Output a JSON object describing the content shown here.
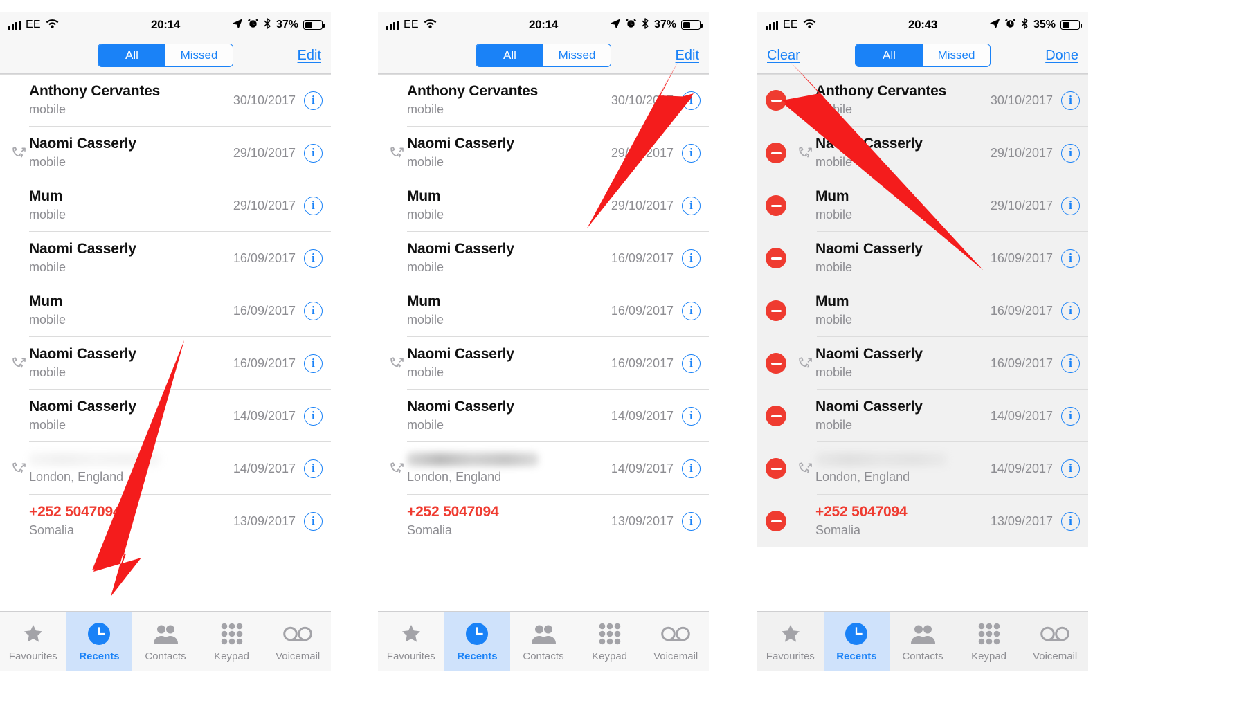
{
  "app": {
    "name": "Phone",
    "screen": "Recents"
  },
  "panels": [
    {
      "id": "panel-1",
      "status": {
        "signal_bars": 4,
        "carrier": "EE",
        "wifi": "wifi-icon",
        "time": "20:14",
        "location_icon": "location-arrow-icon",
        "alarm_icon": "alarm-icon",
        "bluetooth_icon": "bluetooth-icon",
        "battery_percent": "37%",
        "battery_level": 37
      },
      "nav": {
        "left_label": "",
        "segmented": [
          "All",
          "Missed"
        ],
        "selected_segment": "All",
        "right_label": "Edit"
      },
      "editing": false,
      "rows": [
        {
          "name": "Anthony Cervantes",
          "sub": "mobile",
          "date": "30/10/2017",
          "direction": "",
          "missed": false,
          "blurred": false
        },
        {
          "name": "Naomi Casserly",
          "sub": "mobile",
          "date": "29/10/2017",
          "direction": "outgoing",
          "missed": false,
          "blurred": false
        },
        {
          "name": "Mum",
          "sub": "mobile",
          "date": "29/10/2017",
          "direction": "",
          "missed": false,
          "blurred": false
        },
        {
          "name": "Naomi Casserly",
          "sub": "mobile",
          "date": "16/09/2017",
          "direction": "",
          "missed": false,
          "blurred": false
        },
        {
          "name": "Mum",
          "sub": "mobile",
          "date": "16/09/2017",
          "direction": "",
          "missed": false,
          "blurred": false
        },
        {
          "name": "Naomi Casserly",
          "sub": "mobile",
          "date": "16/09/2017",
          "direction": "outgoing",
          "missed": false,
          "blurred": false
        },
        {
          "name": "Naomi Casserly",
          "sub": "mobile",
          "date": "14/09/2017",
          "direction": "",
          "missed": false,
          "blurred": false
        },
        {
          "name": "",
          "sub": "London, England",
          "date": "14/09/2017",
          "direction": "outgoing",
          "missed": false,
          "blurred": true
        },
        {
          "name": "+252 5047094",
          "sub": "Somalia",
          "date": "13/09/2017",
          "direction": "",
          "missed": true,
          "blurred": false
        }
      ],
      "tabs": [
        {
          "label": "Favourites",
          "icon": "star-icon",
          "active": false
        },
        {
          "label": "Recents",
          "icon": "clock-icon",
          "active": true
        },
        {
          "label": "Contacts",
          "icon": "people-icon",
          "active": false
        },
        {
          "label": "Keypad",
          "icon": "keypad-icon",
          "active": false
        },
        {
          "label": "Voicemail",
          "icon": "voicemail-icon",
          "active": false
        }
      ]
    },
    {
      "id": "panel-2",
      "status": {
        "signal_bars": 4,
        "carrier": "EE",
        "wifi": "wifi-icon",
        "time": "20:14",
        "location_icon": "location-arrow-icon",
        "alarm_icon": "alarm-icon",
        "bluetooth_icon": "bluetooth-icon",
        "battery_percent": "37%",
        "battery_level": 37
      },
      "nav": {
        "left_label": "",
        "segmented": [
          "All",
          "Missed"
        ],
        "selected_segment": "All",
        "right_label": "Edit"
      },
      "editing": false,
      "rows": [
        {
          "name": "Anthony Cervantes",
          "sub": "mobile",
          "date": "30/10/2017",
          "direction": "",
          "missed": false,
          "blurred": false
        },
        {
          "name": "Naomi Casserly",
          "sub": "mobile",
          "date": "29/10/2017",
          "direction": "outgoing",
          "missed": false,
          "blurred": false
        },
        {
          "name": "Mum",
          "sub": "mobile",
          "date": "29/10/2017",
          "direction": "",
          "missed": false,
          "blurred": false
        },
        {
          "name": "Naomi Casserly",
          "sub": "mobile",
          "date": "16/09/2017",
          "direction": "",
          "missed": false,
          "blurred": false
        },
        {
          "name": "Mum",
          "sub": "mobile",
          "date": "16/09/2017",
          "direction": "",
          "missed": false,
          "blurred": false
        },
        {
          "name": "Naomi Casserly",
          "sub": "mobile",
          "date": "16/09/2017",
          "direction": "outgoing",
          "missed": false,
          "blurred": false
        },
        {
          "name": "Naomi Casserly",
          "sub": "mobile",
          "date": "14/09/2017",
          "direction": "",
          "missed": false,
          "blurred": false
        },
        {
          "name": "",
          "sub": "London, England",
          "date": "14/09/2017",
          "direction": "outgoing",
          "missed": false,
          "blurred": true
        },
        {
          "name": "+252 5047094",
          "sub": "Somalia",
          "date": "13/09/2017",
          "direction": "",
          "missed": true,
          "blurred": false
        }
      ],
      "tabs": [
        {
          "label": "Favourites",
          "icon": "star-icon",
          "active": false
        },
        {
          "label": "Recents",
          "icon": "clock-icon",
          "active": true
        },
        {
          "label": "Contacts",
          "icon": "people-icon",
          "active": false
        },
        {
          "label": "Keypad",
          "icon": "keypad-icon",
          "active": false
        },
        {
          "label": "Voicemail",
          "icon": "voicemail-icon",
          "active": false
        }
      ]
    },
    {
      "id": "panel-3",
      "status": {
        "signal_bars": 4,
        "carrier": "EE",
        "wifi": "wifi-icon",
        "time": "20:43",
        "location_icon": "location-arrow-icon",
        "alarm_icon": "alarm-icon",
        "bluetooth_icon": "bluetooth-icon",
        "battery_percent": "35%",
        "battery_level": 35
      },
      "nav": {
        "left_label": "Clear",
        "segmented": [
          "All",
          "Missed"
        ],
        "selected_segment": "All",
        "right_label": "Done"
      },
      "editing": true,
      "rows": [
        {
          "name": "Anthony Cervantes",
          "sub": "mobile",
          "date": "30/10/2017",
          "direction": "",
          "missed": false,
          "blurred": false
        },
        {
          "name": "Naomi Casserly",
          "sub": "mobile",
          "date": "29/10/2017",
          "direction": "outgoing",
          "missed": false,
          "blurred": false
        },
        {
          "name": "Mum",
          "sub": "mobile",
          "date": "29/10/2017",
          "direction": "",
          "missed": false,
          "blurred": false
        },
        {
          "name": "Naomi Casserly",
          "sub": "mobile",
          "date": "16/09/2017",
          "direction": "",
          "missed": false,
          "blurred": false
        },
        {
          "name": "Mum",
          "sub": "mobile",
          "date": "16/09/2017",
          "direction": "",
          "missed": false,
          "blurred": false
        },
        {
          "name": "Naomi Casserly",
          "sub": "mobile",
          "date": "16/09/2017",
          "direction": "outgoing",
          "missed": false,
          "blurred": false
        },
        {
          "name": "Naomi Casserly",
          "sub": "mobile",
          "date": "14/09/2017",
          "direction": "",
          "missed": false,
          "blurred": false
        },
        {
          "name": "",
          "sub": "London, England",
          "date": "14/09/2017",
          "direction": "outgoing",
          "missed": false,
          "blurred": true
        },
        {
          "name": "+252 5047094",
          "sub": "Somalia",
          "date": "13/09/2017",
          "direction": "",
          "missed": true,
          "blurred": false
        }
      ],
      "tabs": [
        {
          "label": "Favourites",
          "icon": "star-icon",
          "active": false
        },
        {
          "label": "Recents",
          "icon": "clock-icon",
          "active": true
        },
        {
          "label": "Contacts",
          "icon": "people-icon",
          "active": false
        },
        {
          "label": "Keypad",
          "icon": "keypad-icon",
          "active": false
        },
        {
          "label": "Voicemail",
          "icon": "voicemail-icon",
          "active": false
        }
      ]
    }
  ],
  "annotations": {
    "arrow_color": "#f41c1c",
    "arrows": [
      {
        "name": "arrow-to-recents-tab",
        "target": "Recents tab"
      },
      {
        "name": "arrow-to-edit-button",
        "target": "Edit"
      },
      {
        "name": "arrow-to-clear-button",
        "target": "Clear"
      }
    ]
  },
  "colors": {
    "accent_blue": "#1a82f7",
    "delete_red": "#ef3b30",
    "annotation_red": "#f41c1c",
    "chrome_gray": "#f7f7f7",
    "subtext_gray": "#8d8d92"
  }
}
